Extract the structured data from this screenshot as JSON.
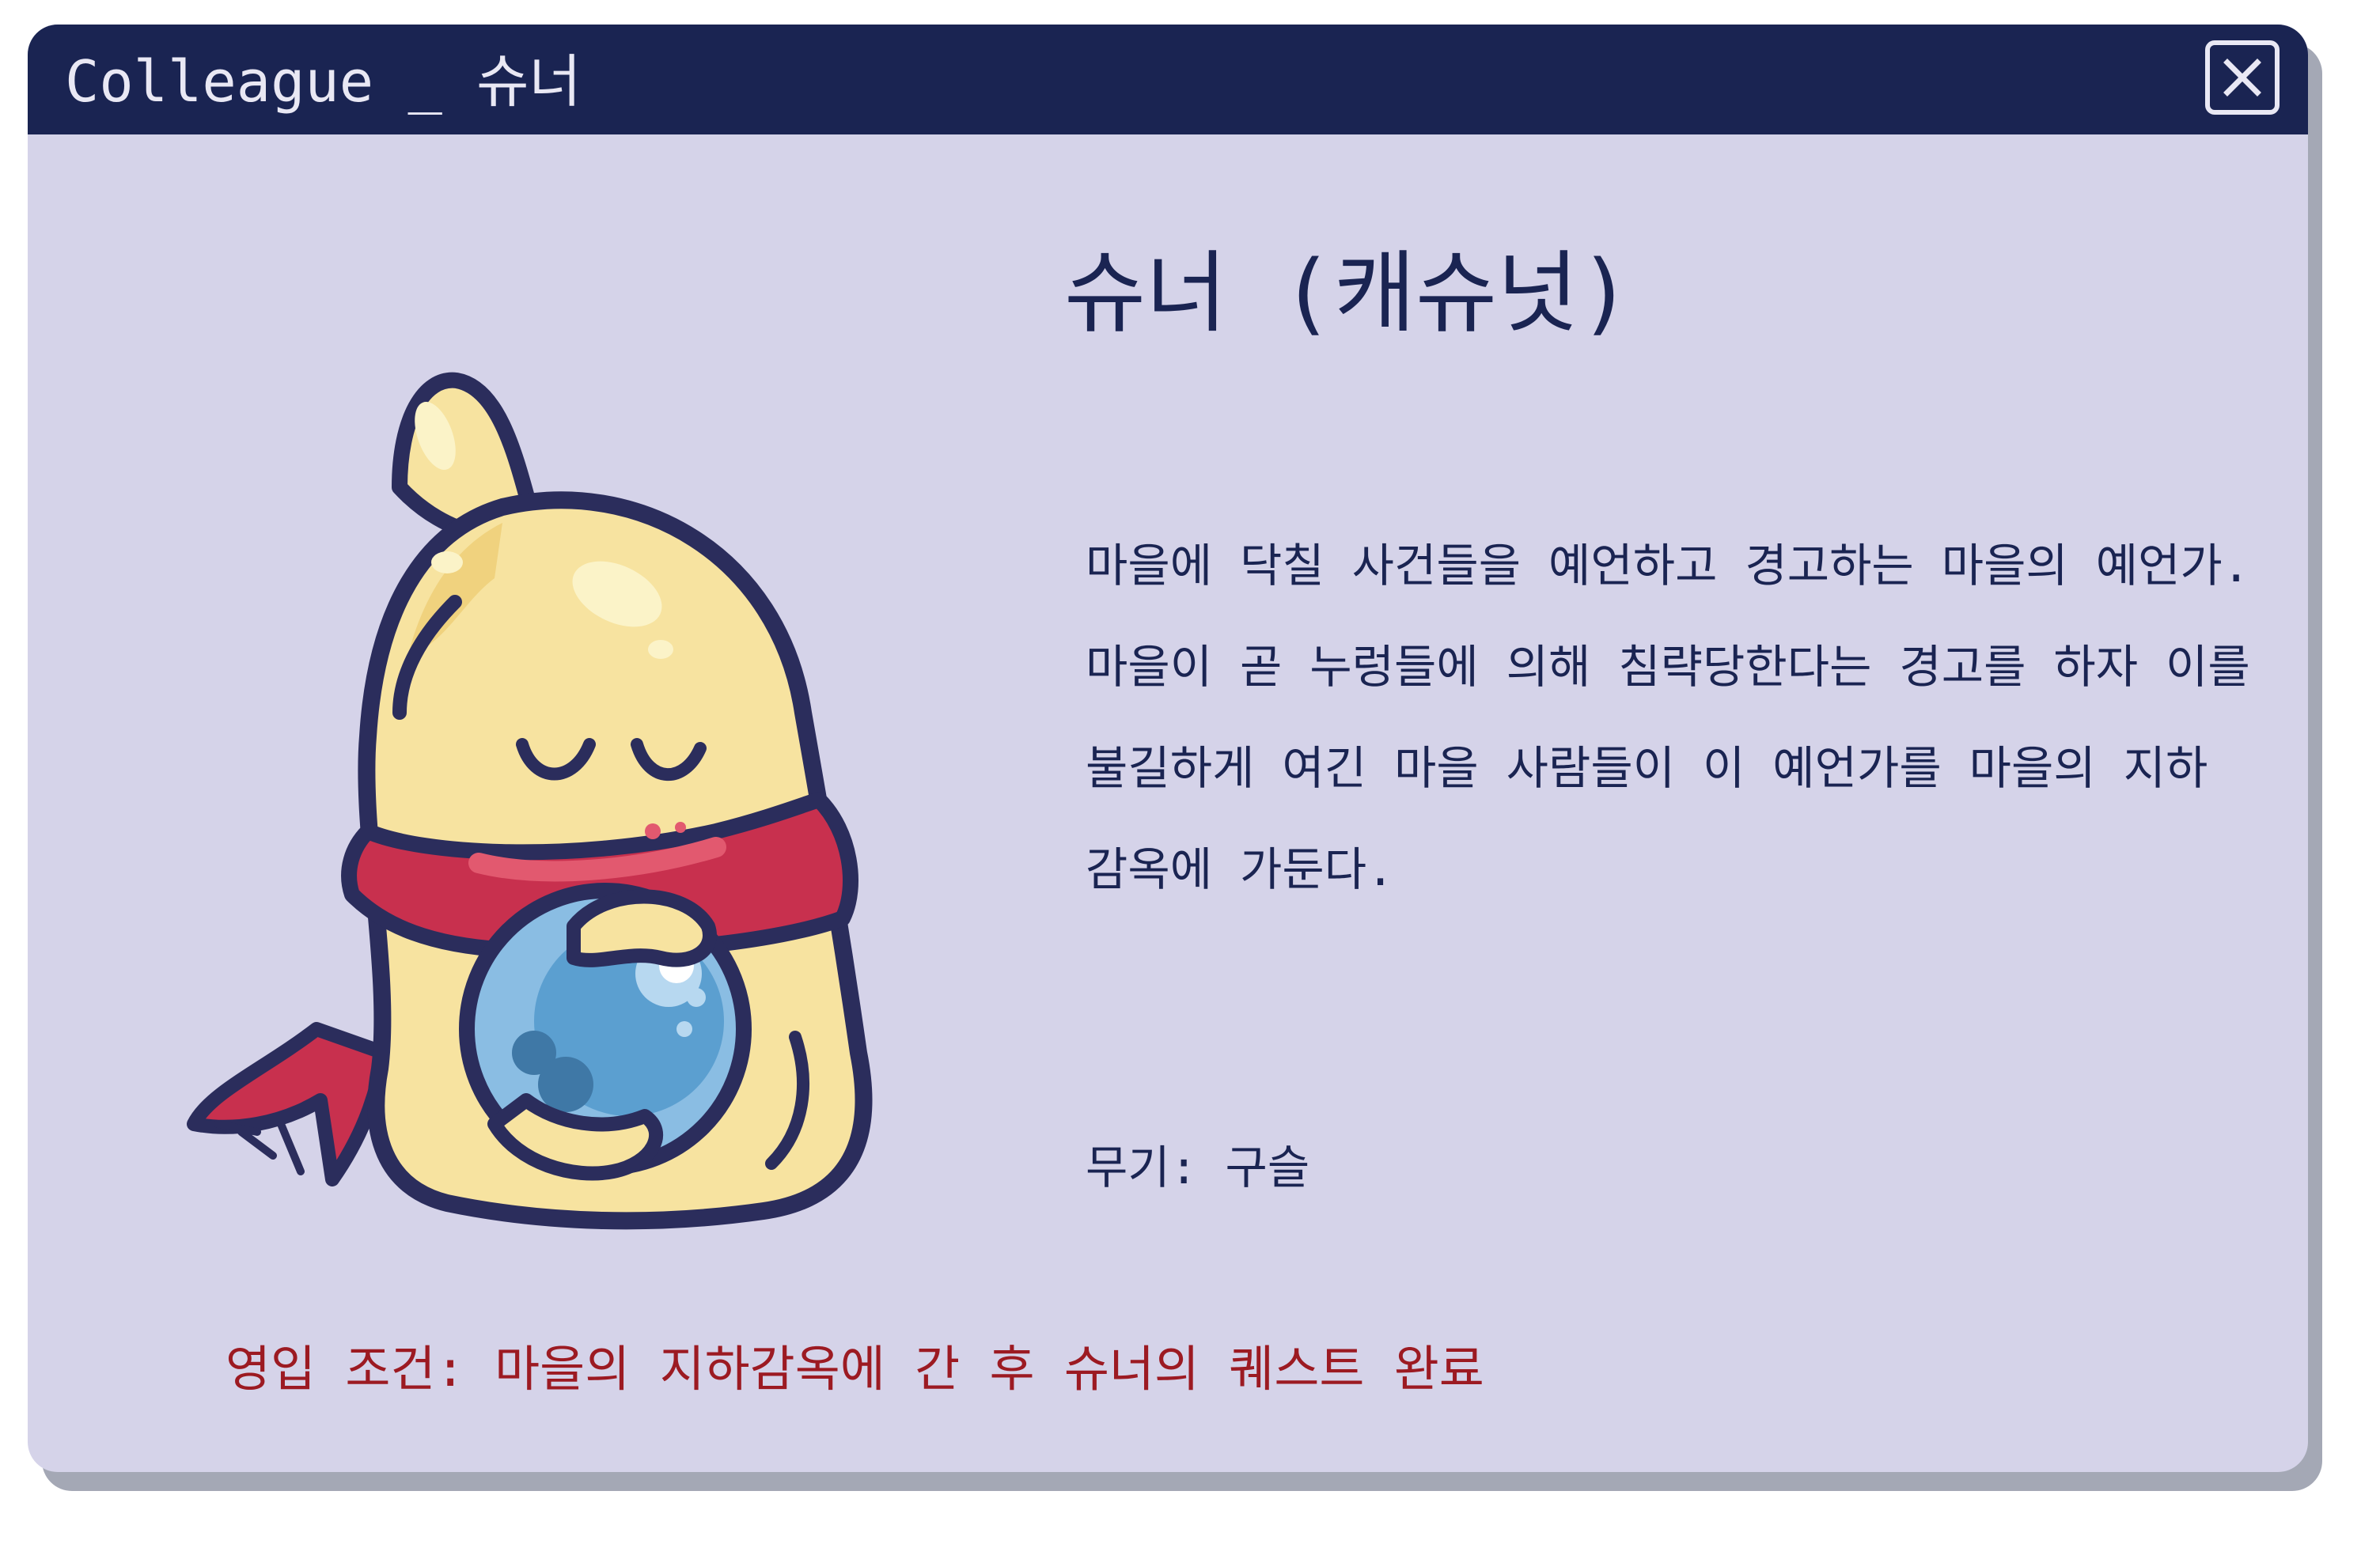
{
  "window": {
    "title": "Colleague _ 슈너"
  },
  "character": {
    "name": "슈너 (캐슈넛)",
    "description_lines": [
      "마을에 닥칠 사건들을 예언하고 경고하는 마을의 예언가.",
      "마을이 곧 누렁들에 의해 침략당한다는 경고를 하자 이를",
      "불길하게 여긴 마을 사람들이 이 예언가를 마을의 지하",
      "감옥에 가둔다."
    ],
    "weapon": "무기: 구슬",
    "recruit_condition": "영입 조건: 마을의 지하감옥에 간 후 슈너의 퀘스트 완료",
    "portrait_icon": "cashew-creature-holding-crystal-ball"
  },
  "colors": {
    "titlebar": "#1a2452",
    "panel": "#d5d3e9",
    "text": "#1a2452",
    "recruit_text": "#9c1a22",
    "body_yellow": "#f7e3a0",
    "scarf_red": "#c8304e",
    "orb_blue": "#5b9fd0"
  }
}
